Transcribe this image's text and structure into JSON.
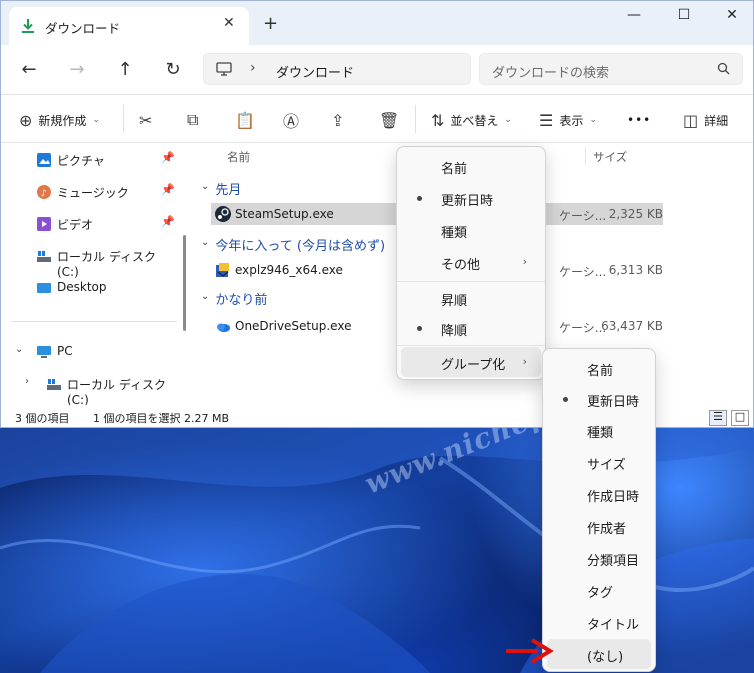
{
  "window": {
    "tab_title": "ダウンロード",
    "new_tab": "+",
    "controls": {
      "minimize": "—",
      "maximize": "☐",
      "close": "✕"
    }
  },
  "nav": {
    "back": "←",
    "forward": "→",
    "up": "↑",
    "refresh": "↻",
    "breadcrumb": "ダウンロード",
    "breadcrumb_sep": "›",
    "search_placeholder": "ダウンロードの検索"
  },
  "toolbar": {
    "new_label": "新規作成",
    "sort_label": "並べ替え",
    "view_label": "表示",
    "more": "•••",
    "details_label": "詳細"
  },
  "sidebar": {
    "items": [
      {
        "label": "ピクチャ",
        "pinned": true,
        "icon": "pictures-icon"
      },
      {
        "label": "ミュージック",
        "pinned": true,
        "icon": "music-icon"
      },
      {
        "label": "ビデオ",
        "pinned": true,
        "icon": "video-icon"
      },
      {
        "label": "ローカル ディスク (C:)",
        "pinned": false,
        "icon": "drive-icon"
      },
      {
        "label": "Desktop",
        "pinned": false,
        "icon": "desktop-icon"
      }
    ],
    "tree": [
      {
        "label": "PC",
        "expander": "⌄"
      },
      {
        "label": "ローカル ディスク (C:)",
        "expander": "›"
      }
    ]
  },
  "filelist": {
    "columns": {
      "name": "名前",
      "size": "サイズ"
    },
    "groups": [
      {
        "label": "先月",
        "files": [
          {
            "name": "SteamSetup.exe",
            "type": "ケーシ...",
            "size": "2,325 KB",
            "selected": true
          }
        ]
      },
      {
        "label": "今年に入って (今月は含めず)",
        "files": [
          {
            "name": "explz946_x64.exe",
            "type": "ケーシ...",
            "size": "6,313 KB",
            "selected": false
          }
        ]
      },
      {
        "label": "かなり前",
        "files": [
          {
            "name": "OneDriveSetup.exe",
            "type": "ケーシ...",
            "size": "63,437 KB",
            "selected": false
          }
        ]
      }
    ]
  },
  "status": {
    "count": "3 個の項目",
    "selection": "1 個の項目を選択  2.27 MB"
  },
  "sort_menu": {
    "items": [
      {
        "label": "名前",
        "checked": false,
        "submenu": false
      },
      {
        "label": "更新日時",
        "checked": true,
        "submenu": false
      },
      {
        "label": "種類",
        "checked": false,
        "submenu": false
      },
      {
        "label": "その他",
        "checked": false,
        "submenu": true
      },
      {
        "label": "昇順",
        "checked": false,
        "submenu": false
      },
      {
        "label": "降順",
        "checked": true,
        "submenu": false
      },
      {
        "label": "グループ化",
        "checked": false,
        "submenu": true,
        "hover": true
      }
    ],
    "submenu_arrow": "›"
  },
  "group_menu": {
    "items": [
      {
        "label": "名前",
        "checked": false
      },
      {
        "label": "更新日時",
        "checked": true
      },
      {
        "label": "種類",
        "checked": false
      },
      {
        "label": "サイズ",
        "checked": false
      },
      {
        "label": "作成日時",
        "checked": false
      },
      {
        "label": "作成者",
        "checked": false
      },
      {
        "label": "分類項目",
        "checked": false
      },
      {
        "label": "タグ",
        "checked": false
      },
      {
        "label": "タイトル",
        "checked": false
      },
      {
        "label": "(なし)",
        "checked": false,
        "hover": true
      }
    ]
  },
  "watermark": "www.nichepcgamer.com",
  "colors": {
    "accent": "#1f4fa8",
    "annotation_arrow": "#e01010",
    "selection": "#d6d6d6"
  }
}
